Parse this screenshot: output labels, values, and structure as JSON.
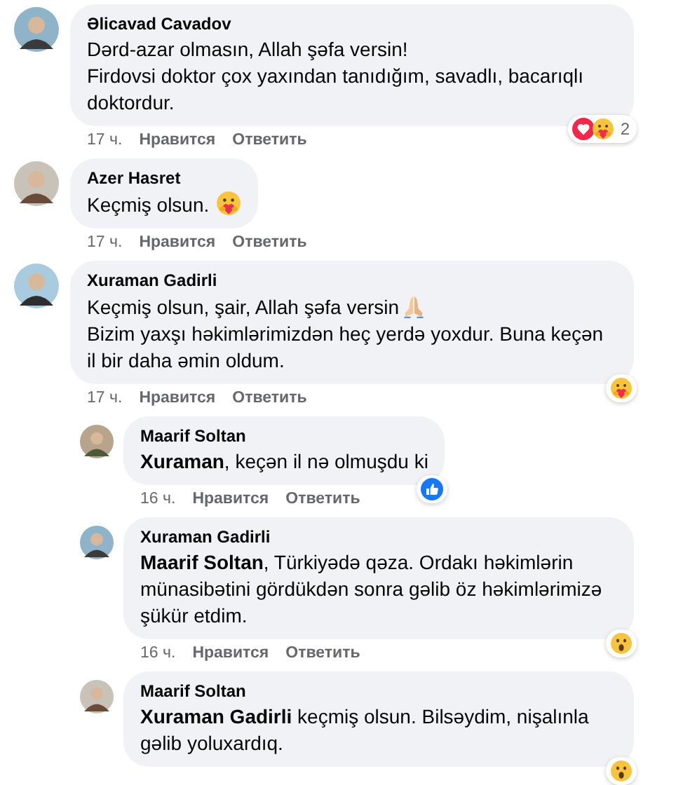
{
  "comments": [
    {
      "author": "Əlicavad Cavadov",
      "paragraphs": [
        {
          "text": "Dərd-azar olmasın, Allah şəfa versin!"
        },
        {
          "text": "Firdovsi doktor çox yaxından tanıdığım, savadlı, bacarıqlı doktordur."
        }
      ],
      "time": "17 ч.",
      "like_label": "Нравится",
      "reply_label": "Ответить",
      "reactions": [
        {
          "kind": "heart"
        },
        {
          "kind": "care"
        }
      ],
      "reaction_count": "2"
    },
    {
      "author": "Azer Hasret",
      "paragraphs": [
        {
          "text": "Keçmiş olsun.",
          "kind": "care"
        }
      ],
      "time": "17 ч.",
      "like_label": "Нравится",
      "reply_label": "Ответить"
    },
    {
      "author": "Xuraman Gadirli",
      "paragraphs": [
        {
          "text": "Keçmiş olsun, şair, Allah şəfa versin",
          "kind": "pray"
        },
        {
          "text": "Bizim yaxşı həkimlərimizdən heç yerdə yoxdur. Buna keçən il bir daha əmin oldum."
        }
      ],
      "time": "17 ч.",
      "like_label": "Нравится",
      "reply_label": "Ответить",
      "reactions": [
        {
          "kind": "care"
        }
      ],
      "children": [
        {
          "author": "Maarif Soltan",
          "paragraphs": [
            {
              "text": "**Xuraman**, keçən il nə olmuşdu ki"
            }
          ],
          "time": "16 ч.",
          "like_label": "Нравится",
          "reply_label": "Ответить",
          "reactions": [
            {
              "kind": "like"
            }
          ]
        },
        {
          "author": "Xuraman Gadirli",
          "paragraphs": [
            {
              "text": "**Maarif Soltan**, Türkiyədə qəza. Ordakı həkimlərin münasibətini gördükdən sonra gəlib öz həkimlərimizə şükür etdim."
            }
          ],
          "time": "16 ч.",
          "like_label": "Нравится",
          "reply_label": "Ответить",
          "reactions": [
            {
              "kind": "wow"
            }
          ]
        },
        {
          "author": "Maarif Soltan",
          "paragraphs": [
            {
              "text": "**Xuraman Gadirli** keçmiş olsun. Bilsəydim, nişalınla gəlib yoluxardıq."
            }
          ],
          "reactions": [
            {
              "kind": "wow"
            }
          ]
        }
      ]
    }
  ]
}
